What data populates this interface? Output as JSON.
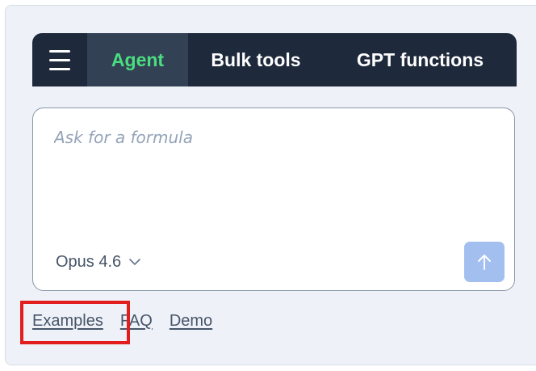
{
  "tabs": {
    "menu_icon": "hamburger-menu-icon",
    "agent_label": "Agent",
    "bulk_label": "Bulk tools",
    "gpt_label": "GPT functions",
    "active": "Agent",
    "active_color": "#4ade80",
    "bar_color": "#1e293b"
  },
  "prompt": {
    "placeholder": "Ask for a formula",
    "value": ""
  },
  "model": {
    "selected": "Opus 4.6",
    "icon": "chevron-down-icon"
  },
  "send": {
    "icon": "arrow-up-icon",
    "color": "#a3bff0"
  },
  "links": {
    "examples": "Examples",
    "faq": "FAQ",
    "demo": "Demo"
  },
  "annotation": {
    "highlighted": "Examples",
    "color": "#e11d1d"
  }
}
